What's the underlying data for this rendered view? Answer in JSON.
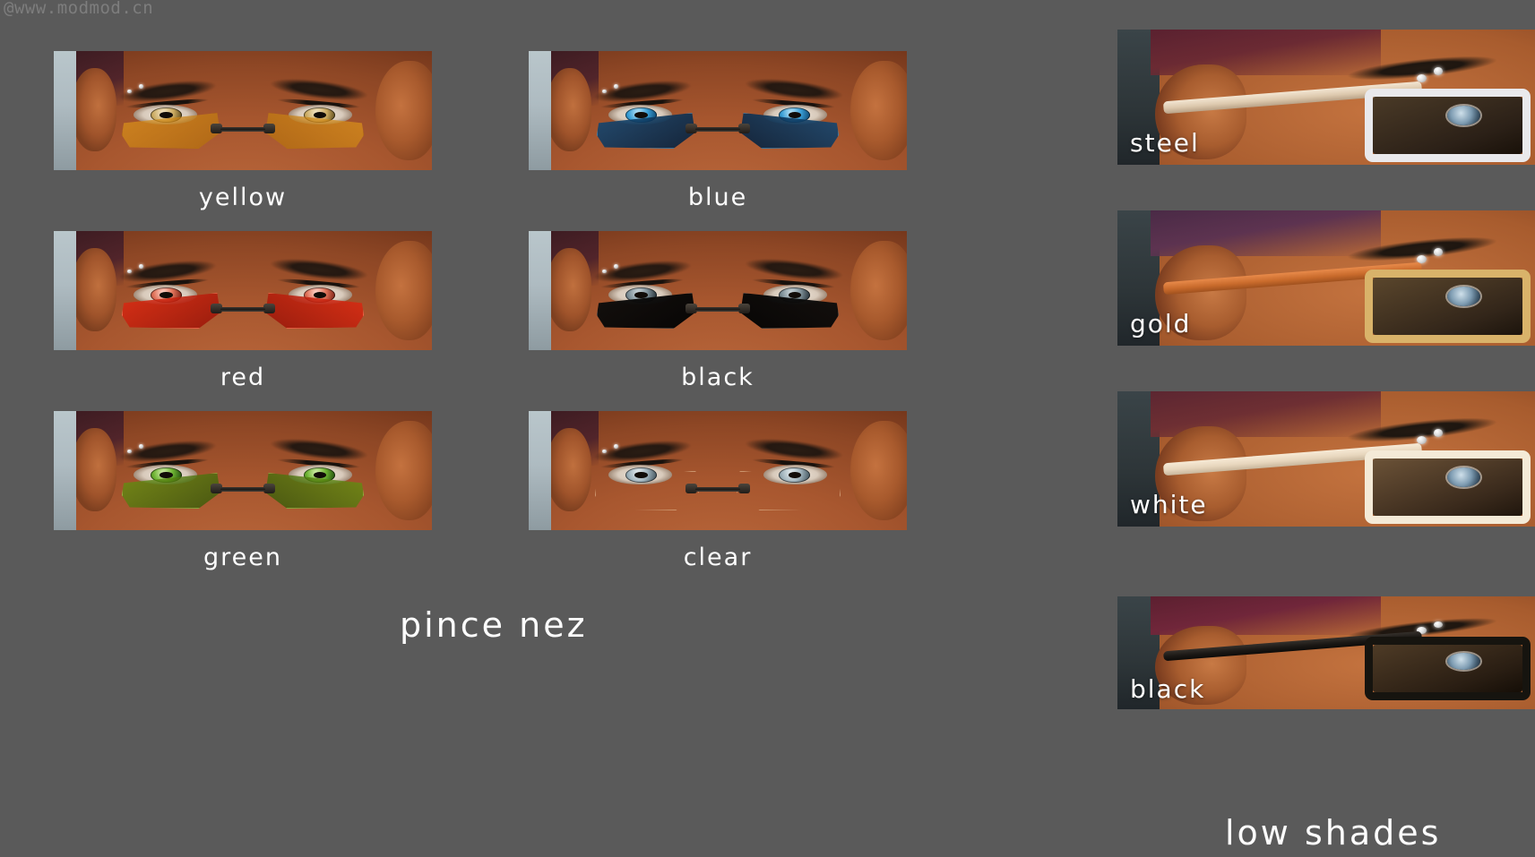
{
  "meta": {
    "background_color": "#5a5a5a",
    "label_color": "#fdfdfd",
    "watermark": "@www.modmod.cn"
  },
  "sections": [
    {
      "id": "pince-nez",
      "title": "pince nez",
      "swatches": [
        {
          "label": "yellow",
          "color": "#d79a2a"
        },
        {
          "label": "blue",
          "color": "#1d6fae"
        },
        {
          "label": "red",
          "color": "#c92a14"
        },
        {
          "label": "black",
          "color": "#0b0b0b"
        },
        {
          "label": "green",
          "color": "#5f8a1e"
        },
        {
          "label": "clear",
          "color": "#d8c9b8"
        }
      ]
    },
    {
      "id": "low-shades",
      "title": "low shades",
      "swatches": [
        {
          "label": "steel",
          "color": "#c9ccd0"
        },
        {
          "label": "gold",
          "color": "#c89a56"
        },
        {
          "label": "white",
          "color": "#f1e4cf"
        },
        {
          "label": "black",
          "color": "#141414"
        }
      ]
    }
  ]
}
